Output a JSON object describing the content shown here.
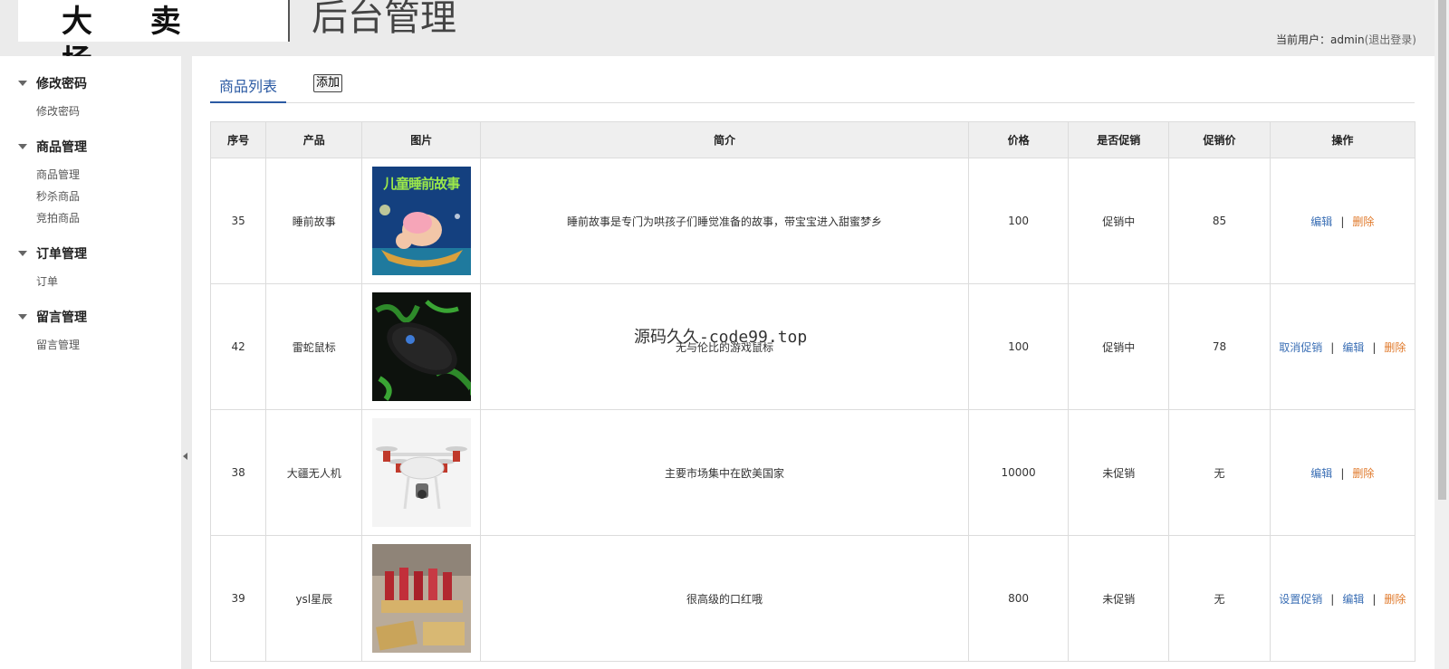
{
  "header": {
    "logo_text": "大 卖 场",
    "admin_title": "后台管理",
    "user_prefix": "当前用户：admin",
    "logout_text": "(退出登录)"
  },
  "sidebar": {
    "groups": [
      {
        "title": "修改密码",
        "items": [
          "修改密码"
        ]
      },
      {
        "title": "商品管理",
        "items": [
          "商品管理",
          "秒杀商品",
          "竞拍商品"
        ]
      },
      {
        "title": "订单管理",
        "items": [
          "订单"
        ]
      },
      {
        "title": "留言管理",
        "items": [
          "留言管理"
        ]
      }
    ]
  },
  "main": {
    "tab_label": "商品列表",
    "add_label": "添加",
    "columns": [
      "序号",
      "产品",
      "图片",
      "简介",
      "价格",
      "是否促销",
      "促销价",
      "操作"
    ],
    "rows": [
      {
        "id": "35",
        "name": "睡前故事",
        "image": "儿童睡前故事",
        "desc": "睡前故事是专门为哄孩子们睡觉准备的故事，带宝宝进入甜蜜梦乡",
        "price": "100",
        "promo": "促销中",
        "promo_price": "85",
        "actions": [
          "编辑",
          "删除"
        ]
      },
      {
        "id": "42",
        "name": "雷蛇鼠标",
        "image": "mouse-image",
        "desc": "无与伦比的游戏鼠标",
        "price": "100",
        "promo": "促销中",
        "promo_price": "78",
        "actions": [
          "取消促销",
          "编辑",
          "删除"
        ]
      },
      {
        "id": "38",
        "name": "大疆无人机",
        "image": "drone-image",
        "desc": "主要市场集中在欧美国家",
        "price": "10000",
        "promo": "未促销",
        "promo_price": "无",
        "actions": [
          "编辑",
          "删除"
        ]
      },
      {
        "id": "39",
        "name": "ysl星辰",
        "image": "lipstick-image",
        "desc": "很高级的口红哦",
        "price": "800",
        "promo": "未促销",
        "promo_price": "无",
        "actions": [
          "设置促销",
          "编辑",
          "删除"
        ]
      }
    ]
  },
  "watermark": "源码久久-code99.top",
  "colors": {
    "link": "#3b6fb5",
    "delete": "#e0792a",
    "tab": "#2b5aa3"
  }
}
